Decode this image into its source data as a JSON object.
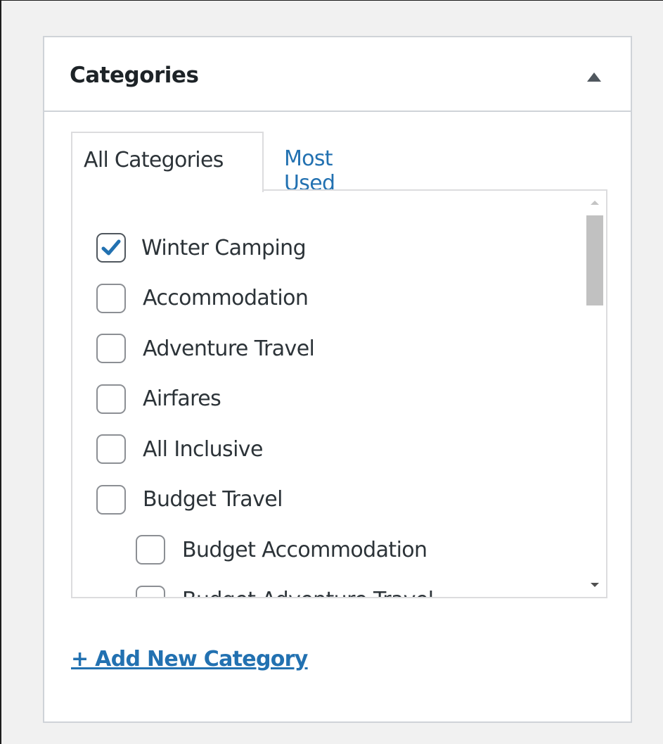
{
  "box": {
    "title": "Categories",
    "toggle_icon": "triangle-up-icon"
  },
  "tabs": {
    "all_label": "All Categories",
    "most_used_label": "Most Used"
  },
  "categories": [
    {
      "label": "Winter Camping",
      "checked": true,
      "level": 0
    },
    {
      "label": "Accommodation",
      "checked": false,
      "level": 0
    },
    {
      "label": "Adventure Travel",
      "checked": false,
      "level": 0
    },
    {
      "label": "Airfares",
      "checked": false,
      "level": 0
    },
    {
      "label": "All Inclusive",
      "checked": false,
      "level": 0
    },
    {
      "label": "Budget Travel",
      "checked": false,
      "level": 0
    },
    {
      "label": "Budget Accommodation",
      "checked": false,
      "level": 1
    },
    {
      "label": "Budget Adventure Travel",
      "checked": false,
      "level": 1
    }
  ],
  "add_link": "+ Add New Category",
  "colors": {
    "link": "#2271b1",
    "checkmark": "#2271b1",
    "text": "#2c3338"
  }
}
